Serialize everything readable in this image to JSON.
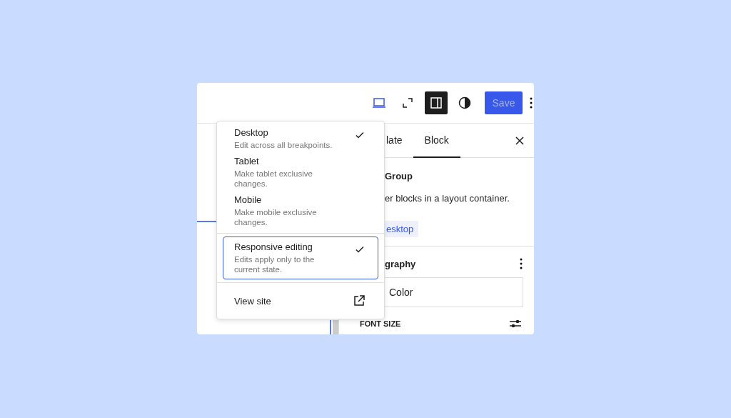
{
  "toolbar": {
    "device_button": {
      "selected": true
    },
    "sidebar_button": {
      "pressed": true
    },
    "save_button": {
      "label": "Save",
      "disabled": true
    }
  },
  "sidebar": {
    "tabs": [
      {
        "label": "late",
        "selected": false
      },
      {
        "label": "Block",
        "selected": true
      }
    ],
    "block_title": "Group",
    "block_description": "er blocks in a layout container.",
    "tag": "esktop",
    "section_title": "graphy",
    "color_field": "Color",
    "font_size_label": "FONT SIZE"
  },
  "device_menu": {
    "devices": [
      {
        "label": "Desktop",
        "description": "Edit across all breakpoints.",
        "checked": true
      },
      {
        "label": "Tablet",
        "description": "Make tablet exclusive changes.",
        "checked": false
      },
      {
        "label": "Mobile",
        "description": "Make mobile exclusive changes.",
        "checked": false
      }
    ],
    "responsive_editing": {
      "label": "Responsive editing",
      "description": "Edits apply only to the current state.",
      "checked": true,
      "focused": true
    },
    "view_site": "View site"
  }
}
